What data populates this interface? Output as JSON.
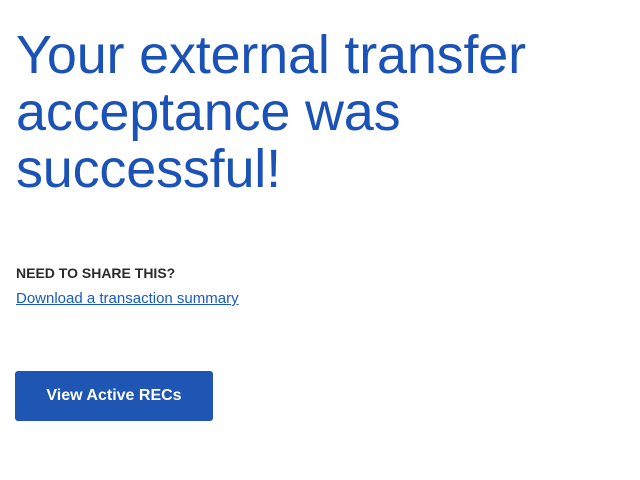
{
  "headline": {
    "lines": [
      "Your external transfer",
      "acceptance was",
      "successful!"
    ]
  },
  "share": {
    "label": "NEED TO SHARE THIS?",
    "download_link": "Download a transaction summary"
  },
  "actions": {
    "primary_button": "View Active RECs"
  },
  "colors": {
    "headline": "#1a52b8",
    "link": "#1659c7",
    "button_bg": "#1f56b3",
    "button_text": "#ffffff",
    "label": "#2b2b2b"
  }
}
